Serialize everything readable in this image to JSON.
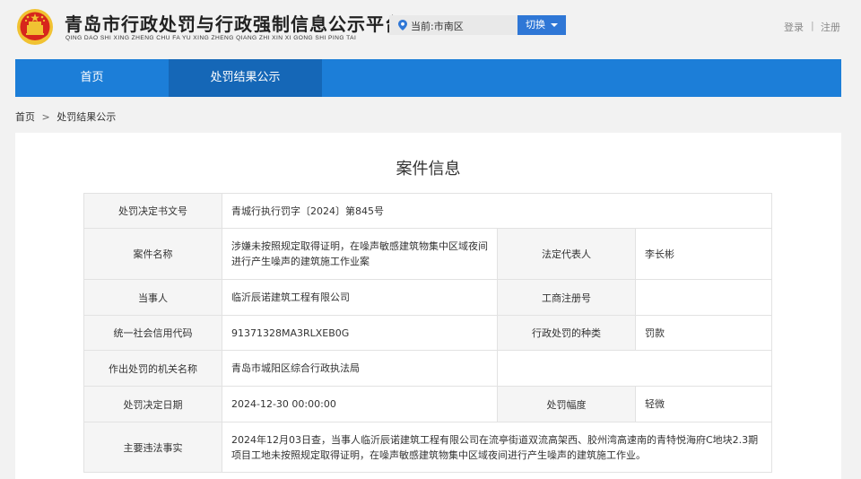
{
  "header": {
    "title": "青岛市行政处罚与行政强制信息公示平台",
    "title_pinyin": "QING DAO SHI XING ZHENG CHU FA YU XING ZHENG QIANG ZHI XIN XI GONG SHI PING TAI",
    "location_text": "当前:市南区",
    "switch_label": "切换",
    "login_label": "登录",
    "separator": "|",
    "register_label": "注册"
  },
  "nav": {
    "items": [
      {
        "label": "首页"
      },
      {
        "label": "处罚结果公示"
      }
    ]
  },
  "breadcrumb": {
    "home": "首页",
    "arrow": ">",
    "current": "处罚结果公示"
  },
  "case": {
    "heading": "案件信息",
    "rows": {
      "decision_no_label": "处罚决定书文号",
      "decision_no_value": "青城行执行罚字〔2024〕第845号",
      "case_name_label": "案件名称",
      "case_name_value": "涉嫌未按照规定取得证明，在噪声敏感建筑物集中区域夜间进行产生噪声的建筑施工作业案",
      "legal_rep_label": "法定代表人",
      "legal_rep_value": "李长彬",
      "party_label": "当事人",
      "party_value": "临沂辰诺建筑工程有限公司",
      "biz_reg_label": "工商注册号",
      "biz_reg_value": "",
      "credit_code_label": "统一社会信用代码",
      "credit_code_value": "91371328MA3RLXEB0G",
      "penalty_type_label": "行政处罚的种类",
      "penalty_type_value": "罚款",
      "authority_label": "作出处罚的机关名称",
      "authority_value": "青岛市城阳区综合行政执法局",
      "decision_date_label": "处罚决定日期",
      "decision_date_value": "2024-12-30 00:00:00",
      "penalty_range_label": "处罚幅度",
      "penalty_range_value": "轻微",
      "facts_label": "主要违法事实",
      "facts_value": "2024年12月03日查，当事人临沂辰诺建筑工程有限公司在流亭街道双流高架西、胶州湾高速南的青特悦海府C地块2.3期项目工地未按照规定取得证明，在噪声敏感建筑物集中区域夜间进行产生噪声的建筑施工作业。"
    }
  },
  "colors": {
    "nav_bg": "#1c7ed8",
    "nav_active": "#1567b7",
    "switch_btn": "#2f77d6",
    "emblem_red": "#d7261c",
    "emblem_gold": "#f1c232"
  },
  "icons": {
    "emblem": "national-emblem-icon",
    "location": "location-pin-icon",
    "caret": "caret-down-icon"
  }
}
